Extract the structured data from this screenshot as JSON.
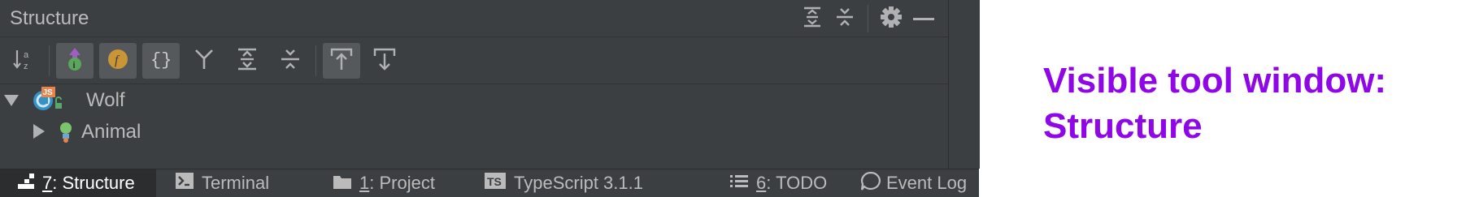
{
  "tool_window": {
    "title": "Structure",
    "title_actions": [
      "expand-all-icon",
      "collapse-all-icon",
      "gear-icon",
      "minimize-icon"
    ],
    "toolbar": [
      {
        "icon": "sort-alphabetically-icon",
        "active": false
      },
      {
        "icon": "show-inherited-icon",
        "active": true
      },
      {
        "icon": "show-fields-icon",
        "glyph": "f",
        "active": true
      },
      {
        "icon": "show-object-literals-icon",
        "glyph": "{}",
        "active": true
      },
      {
        "icon": "group-icon",
        "active": false
      },
      {
        "icon": "expand-all-icon",
        "active": false
      },
      {
        "icon": "collapse-all-icon",
        "active": false
      },
      {
        "icon": "autoscroll-to-source-icon",
        "active": true
      },
      {
        "icon": "autoscroll-from-source-icon",
        "active": false
      }
    ],
    "tree": [
      {
        "label": "Wolf",
        "expanded": true,
        "badge": "JS"
      },
      {
        "label": "Animal",
        "expanded": false
      }
    ]
  },
  "bottom_tabs": [
    {
      "num": "7",
      "label": ": Structure",
      "active": true
    },
    {
      "num": "",
      "label": "Terminal",
      "active": false
    },
    {
      "num": "1",
      "label": ": Project",
      "active": false
    },
    {
      "num": "",
      "label": "TypeScript 3.1.1",
      "badge": "TS",
      "active": false
    },
    {
      "num": "6",
      "label": ": TODO",
      "active": false
    },
    {
      "num": "",
      "label": "Event Log",
      "active": false
    }
  ],
  "caption": {
    "line1": "Visible tool window:",
    "line2": "Structure"
  },
  "colors": {
    "ide_bg": "#3c3f41",
    "text": "#bbbbbb",
    "caption": "#8f07e6"
  }
}
